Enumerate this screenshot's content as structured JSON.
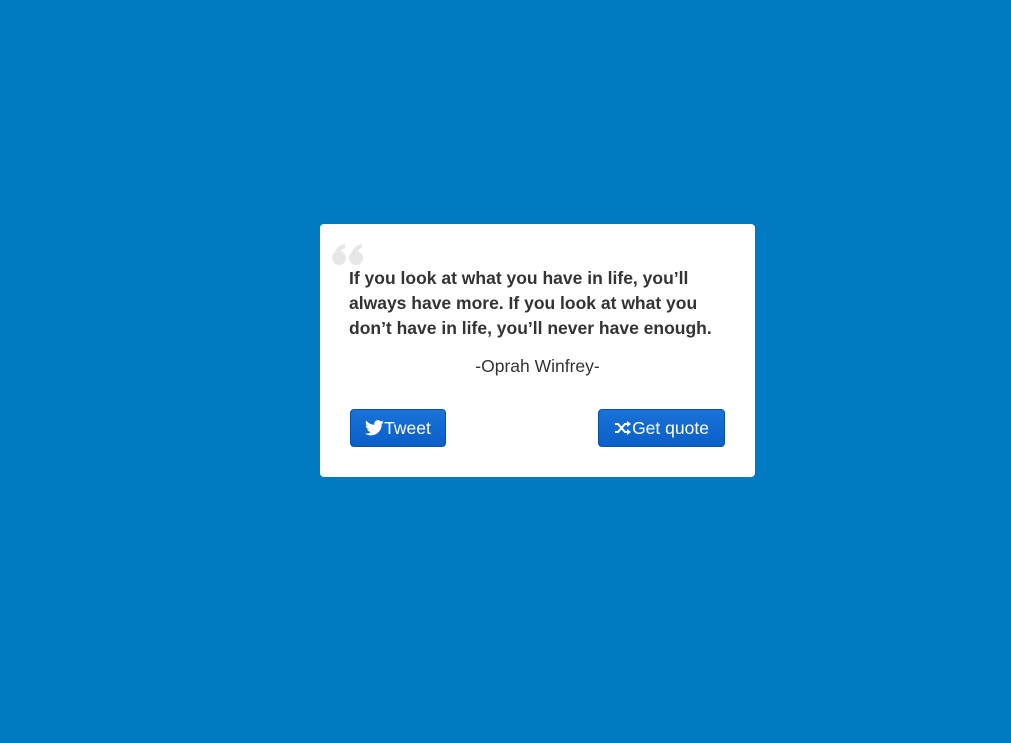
{
  "quote": {
    "text": "If you look at what you have in life, you’ll always have more. If you look at what you don’t have in life, you’ll never have enough.",
    "author": "-Oprah Winfrey-"
  },
  "buttons": {
    "tweet_label": "Tweet",
    "tweet_icon": "twitter-icon",
    "new_quote_label": "Get quote",
    "new_quote_icon": "shuffle-icon"
  },
  "colors": {
    "background": "#007bc2",
    "card": "#ffffff",
    "button": "#0a5fc8",
    "text": "#333333",
    "quote_mark": "#e6e6e6"
  }
}
